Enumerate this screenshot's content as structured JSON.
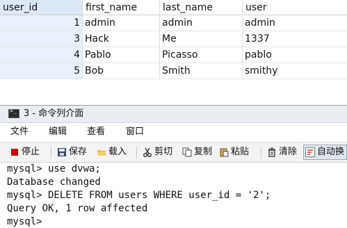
{
  "grid": {
    "columns": [
      "user_id",
      "first_name",
      "last_name",
      "user"
    ],
    "rows": [
      {
        "user_id": "1",
        "first_name": "admin",
        "last_name": "admin",
        "user": "admin"
      },
      {
        "user_id": "3",
        "first_name": "Hack",
        "last_name": "Me",
        "user": "1337"
      },
      {
        "user_id": "4",
        "first_name": "Pablo",
        "last_name": "Picasso",
        "user": "pablo"
      },
      {
        "user_id": "5",
        "first_name": "Bob",
        "last_name": "Smith",
        "user": "smithy"
      }
    ]
  },
  "console": {
    "title": "3 - 命令列介面",
    "menu": [
      "文件",
      "编辑",
      "查看",
      "窗口"
    ],
    "toolbar": {
      "stop": "停止",
      "save": "保存",
      "load": "载入",
      "cut": "剪切",
      "copy": "复制",
      "paste": "粘贴",
      "clear": "清除",
      "autowrap": "自动换"
    },
    "lines": [
      "mysql> use dvwa;",
      "Database changed",
      "mysql> DELETE FROM users WHERE user_id = '2';",
      "Query OK, 1 row affected",
      "mysql>"
    ]
  },
  "colors": {
    "stop_icon": "#d40000",
    "selected_column": "#e8f1fb"
  },
  "icons": [
    "terminal-icon",
    "stop-icon",
    "save-icon",
    "folder-open-icon",
    "scissors-icon",
    "copy-icon",
    "paste-icon",
    "trash-icon",
    "wrap-icon"
  ]
}
